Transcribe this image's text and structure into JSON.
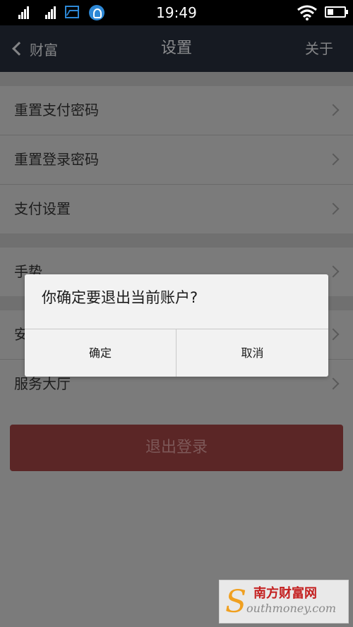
{
  "status_bar": {
    "time": "19:49",
    "icons": [
      "signal-icon",
      "signal-icon",
      "gallery-icon",
      "app-notification-icon",
      "wifi-icon",
      "battery-icon"
    ]
  },
  "header": {
    "back_label": "财富",
    "title": "设置",
    "about_label": "关于"
  },
  "settings": {
    "group1": [
      "重置支付密码",
      "重置登录密码",
      "支付设置"
    ],
    "group2": [
      "手势",
      "安",
      "服务大厅"
    ]
  },
  "logout_label": "退出登录",
  "dialog": {
    "message": "你确定要退出当前账户?",
    "confirm": "确定",
    "cancel": "取消"
  },
  "watermark": {
    "brand": "南方财富网",
    "domain": "outhmoney.com",
    "logo": "S"
  },
  "colors": {
    "title_bar": "#161a22",
    "logout": "#5b2626",
    "dialog_bg": "#f2f2f2"
  }
}
